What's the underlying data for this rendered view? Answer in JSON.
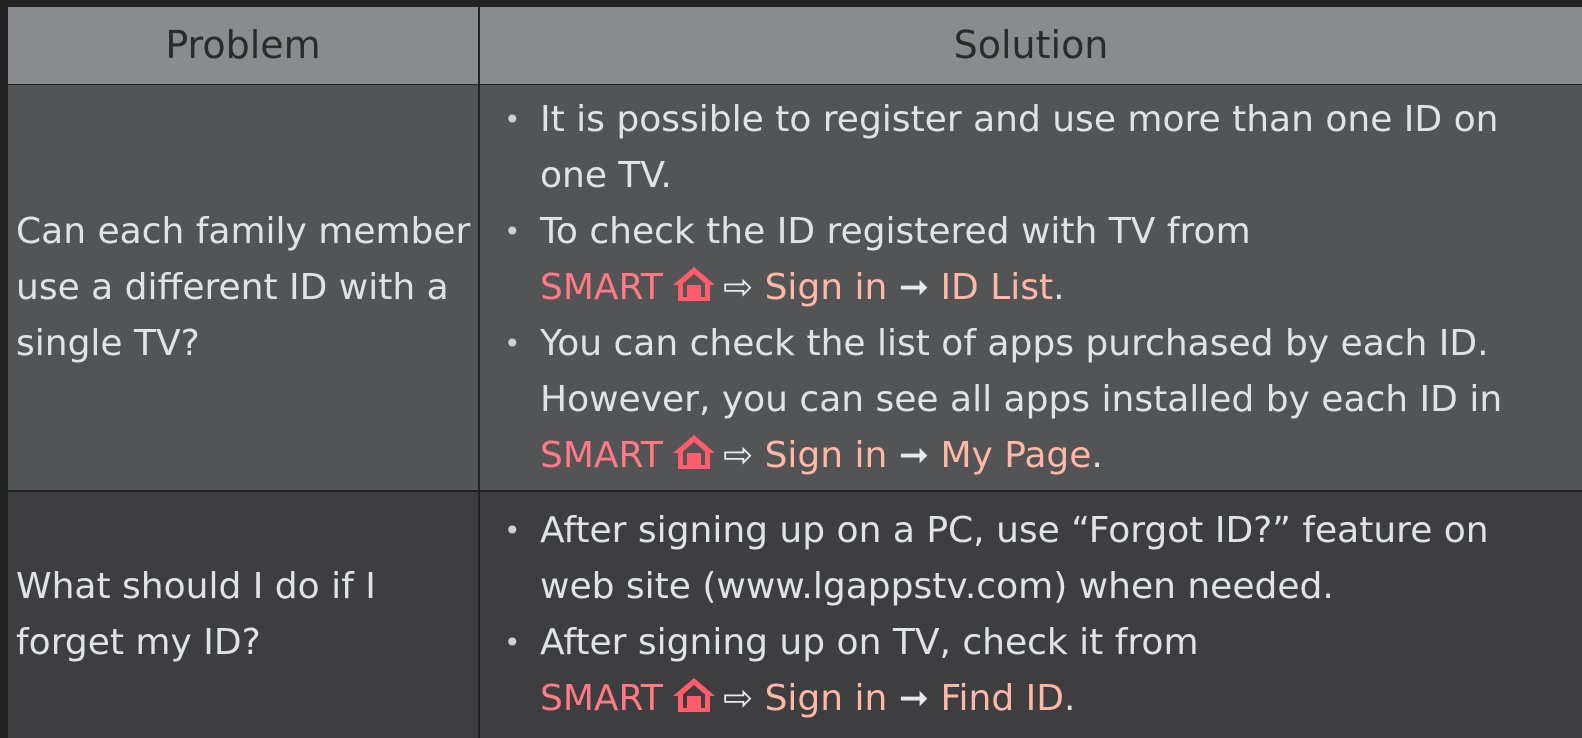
{
  "header": {
    "problem": "Problem",
    "solution": "Solution"
  },
  "rows": [
    {
      "problem": "Can each family member use a different ID with a single TV?",
      "bullets": [
        {
          "text": "It is possible to register and use more than one ID on one TV."
        },
        {
          "text": "To check the ID registered with TV from",
          "path": {
            "smart": "SMART",
            "arrow1": "⇨",
            "signin": "Sign in",
            "arrow2": "➞",
            "target": "ID List",
            "end": "."
          }
        },
        {
          "text": "You can check the list of apps purchased by each ID. However, you can see all apps installed by each ID in",
          "path": {
            "smart": "SMART",
            "arrow1": "⇨",
            "signin": "Sign in",
            "arrow2": "➞",
            "target": "My Page",
            "end": "."
          }
        }
      ]
    },
    {
      "problem": "What should I do if I forget my ID?",
      "bullets": [
        {
          "text": "After signing up on a PC, use “Forgot ID?” feature on web site (www.lgappstv.com) when needed."
        },
        {
          "text": "After signing up on TV, check it from",
          "path": {
            "smart": "SMART",
            "arrow1": "⇨",
            "signin": "Sign in",
            "arrow2": "➞",
            "target": "Find ID",
            "end": "."
          }
        }
      ]
    }
  ],
  "bullet_glyph": "•",
  "icons": {
    "home": "home-icon"
  },
  "colors": {
    "header_bg": "#898b8e",
    "row1_bg": "#535456",
    "row2_bg": "#3e3e40",
    "smart_text": "#ff7a85",
    "menu_text": "#ffb8a6",
    "home_icon": "#ff5d6c"
  }
}
